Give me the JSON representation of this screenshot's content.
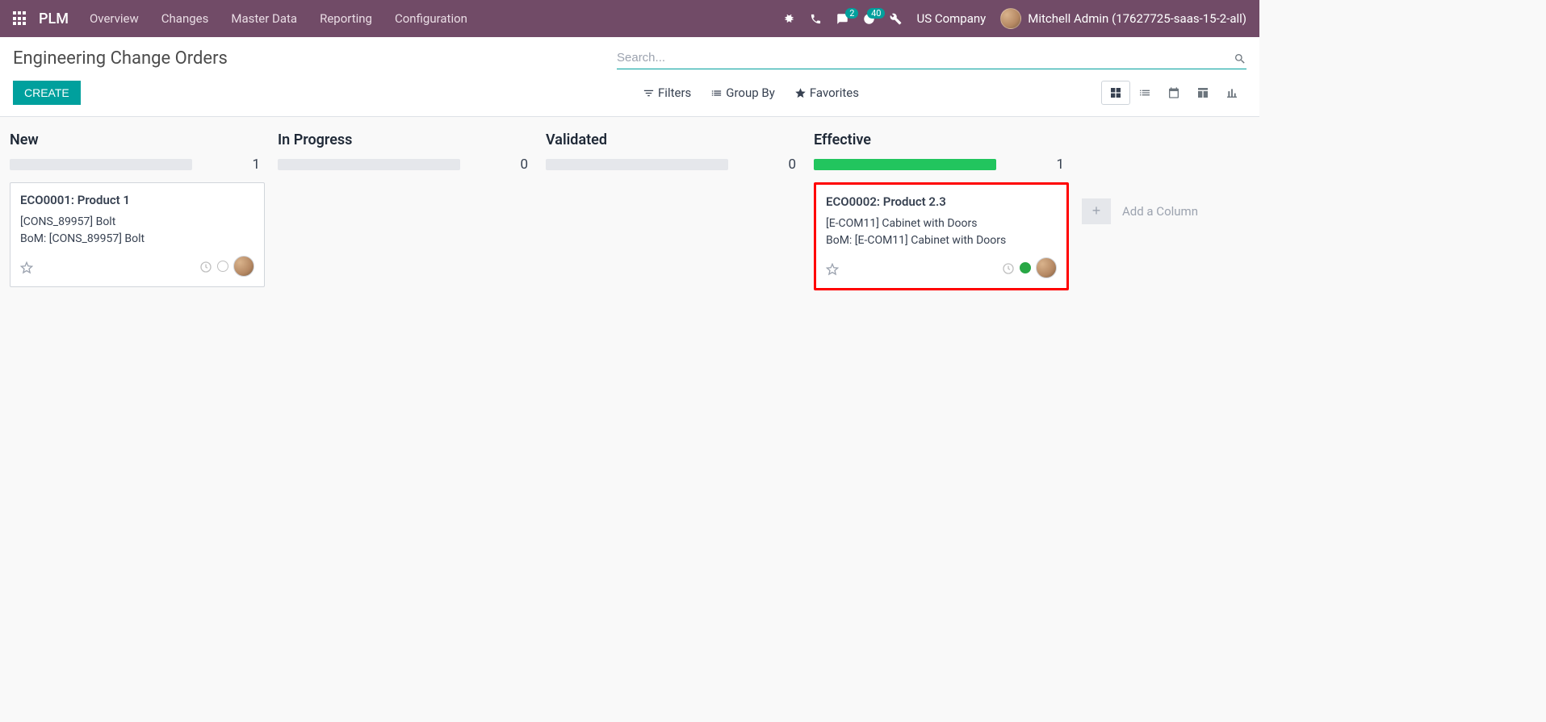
{
  "nav": {
    "brand": "PLM",
    "menu": [
      "Overview",
      "Changes",
      "Master Data",
      "Reporting",
      "Configuration"
    ],
    "discuss_badge": "2",
    "activities_badge": "40",
    "company": "US Company",
    "user": "Mitchell Admin (17627725-saas-15-2-all)"
  },
  "panel": {
    "breadcrumb": "Engineering Change Orders",
    "search_placeholder": "Search...",
    "create_label": "CREATE",
    "filters_label": "Filters",
    "groupby_label": "Group By",
    "favorites_label": "Favorites"
  },
  "columns": [
    {
      "title": "New",
      "count": "1",
      "progress": 0
    },
    {
      "title": "In Progress",
      "count": "0",
      "progress": 0
    },
    {
      "title": "Validated",
      "count": "0",
      "progress": 0
    },
    {
      "title": "Effective",
      "count": "1",
      "progress": 100
    }
  ],
  "cards": {
    "c0": {
      "title": "ECO0001: Product 1",
      "line1": "[CONS_89957] Bolt",
      "line2": "BoM: [CONS_89957] Bolt"
    },
    "c3": {
      "title": "ECO0002: Product 2.3",
      "line1": "[E-COM11] Cabinet with Doors",
      "line2": "BoM: [E-COM11] Cabinet with Doors"
    }
  },
  "add_column": {
    "label": "Add a Column",
    "plus": "+"
  }
}
